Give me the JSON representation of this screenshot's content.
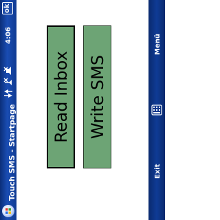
{
  "title_bar": {
    "title": "Touch SMS - Startpage",
    "time": "4:06",
    "ok_label": "ok"
  },
  "buttons": {
    "read_inbox": "Read Inbox",
    "write_sms": "Write SMS"
  },
  "softkeys": {
    "left": "Exit",
    "right": "Menü",
    "center_icon": "keyboard-icon"
  },
  "colors": {
    "button_green": "#6da475",
    "title_bar_blue": "#1a4db3",
    "softkey_bar_blue": "#0f3b95"
  },
  "status_icons": [
    "sync-icon",
    "antenna-off-icon",
    "volume-off-icon"
  ]
}
